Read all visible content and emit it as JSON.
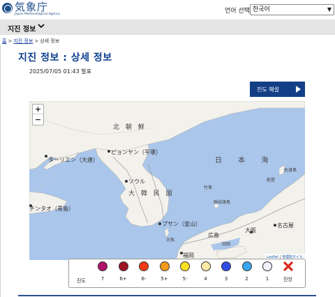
{
  "header": {
    "logo_kanji": "気象庁",
    "logo_en": "Japan Meteorological Agency",
    "lang_label": "언어 선택",
    "lang_value": "한국어"
  },
  "navbar": {
    "title": "지진 정보"
  },
  "breadcrumb": {
    "home": "홈",
    "section": "지진 정보",
    "current": "상세 정보",
    "sep": ">"
  },
  "page": {
    "title": "지진 정보 : 상세 정보",
    "published": "2025/07/05 01:43 발표",
    "intensity_button": "진도 해설"
  },
  "map": {
    "zoom_in": "+",
    "zoom_out": "−",
    "attribution_leaflet": "Leaflet",
    "attribution_sep": " | ",
    "attribution_tiles": "地理院タイル",
    "labels": {
      "north_korea": "北 朝 鮮",
      "pyongyang": "ピョンヤン（平壌）",
      "dalian": "ターリエン（大連）",
      "seoul": "ソウル",
      "south_korea": "大 韓 民 国",
      "qingdao": "チンタオ（青島）",
      "sea_of_japan": "日 本 海",
      "takeshima": "竹島",
      "oki": "隠岐諸島",
      "busan": "プサン（釜山）",
      "tsushima": "対馬",
      "fukuoka": "福岡",
      "hiroshima": "広島",
      "shikoku": "四国",
      "osaka": "大阪",
      "nagoya": "名古屋",
      "sado": "佐渡島",
      "noto": "能登"
    }
  },
  "legend": {
    "title": "진도",
    "items": [
      {
        "label": "7",
        "color": "#b0106c"
      },
      {
        "label": "6+",
        "color": "#a11424"
      },
      {
        "label": "6-",
        "color": "#f33a17"
      },
      {
        "label": "5+",
        "color": "#f59a1f"
      },
      {
        "label": "5-",
        "color": "#fbe020"
      },
      {
        "label": "4",
        "color": "#fbe9a6"
      },
      {
        "label": "3",
        "color": "#2f4de6"
      },
      {
        "label": "2",
        "color": "#38a6ee"
      },
      {
        "label": "1",
        "color": "#f1f1fb"
      }
    ],
    "epicenter_label": "진앙",
    "epicenter_color": "#d6281a",
    "epicenter_icon": "x-mark-icon"
  }
}
